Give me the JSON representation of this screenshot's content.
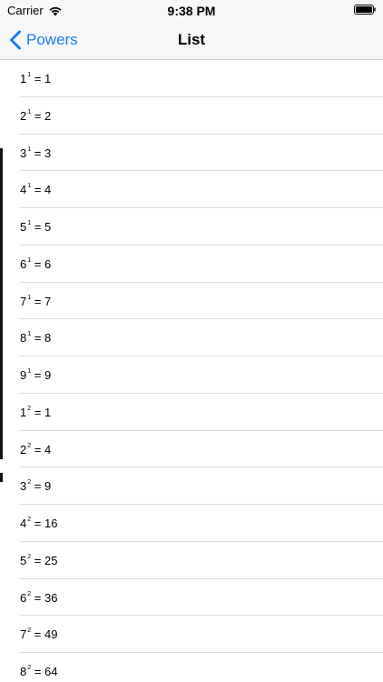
{
  "status_bar": {
    "carrier": "Carrier",
    "time": "9:38 PM"
  },
  "nav": {
    "back_label": "Powers",
    "title": "List"
  },
  "rows": [
    {
      "base": "1",
      "exp": "1",
      "result": "1"
    },
    {
      "base": "2",
      "exp": "1",
      "result": "2"
    },
    {
      "base": "3",
      "exp": "1",
      "result": "3"
    },
    {
      "base": "4",
      "exp": "1",
      "result": "4"
    },
    {
      "base": "5",
      "exp": "1",
      "result": "5"
    },
    {
      "base": "6",
      "exp": "1",
      "result": "6"
    },
    {
      "base": "7",
      "exp": "1",
      "result": "7"
    },
    {
      "base": "8",
      "exp": "1",
      "result": "8"
    },
    {
      "base": "9",
      "exp": "1",
      "result": "9"
    },
    {
      "base": "1",
      "exp": "2",
      "result": "1"
    },
    {
      "base": "2",
      "exp": "2",
      "result": "4"
    },
    {
      "base": "3",
      "exp": "2",
      "result": "9"
    },
    {
      "base": "4",
      "exp": "2",
      "result": "16"
    },
    {
      "base": "5",
      "exp": "2",
      "result": "25"
    },
    {
      "base": "6",
      "exp": "2",
      "result": "36"
    },
    {
      "base": "7",
      "exp": "2",
      "result": "49"
    },
    {
      "base": "8",
      "exp": "2",
      "result": "64"
    }
  ],
  "colors": {
    "accent": "#1a7cf6",
    "bar_background": "#f7f7f7",
    "separator": "#dcdcdf"
  }
}
